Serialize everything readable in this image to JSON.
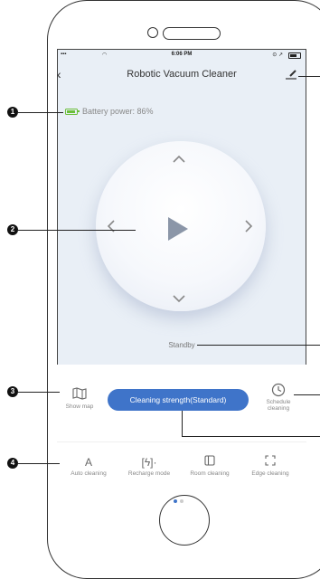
{
  "status_bar": {
    "time": "6:06 PM"
  },
  "header": {
    "title": "Robotic Vacuum Cleaner"
  },
  "battery": {
    "label": "Battery power: 86%",
    "level": 0.86,
    "color": "#6bbf3a"
  },
  "state": {
    "label": "Standby"
  },
  "controls": {
    "show_map": "Show map",
    "strength_button": "Cleaning strength(Standard)",
    "schedule": "Schedule cleaning"
  },
  "modes": [
    {
      "label": "Auto cleaning",
      "icon": "auto-cleaning-icon"
    },
    {
      "label": "Recharge mode",
      "icon": "recharge-icon"
    },
    {
      "label": "Room cleaning",
      "icon": "room-cleaning-icon"
    },
    {
      "label": "Edge cleaning",
      "icon": "edge-cleaning-icon"
    }
  ],
  "callouts": [
    "1",
    "2",
    "3",
    "4"
  ],
  "colors": {
    "accent": "#3f74c9",
    "screen_bg": "#e9eff6",
    "callout": "#111111"
  }
}
